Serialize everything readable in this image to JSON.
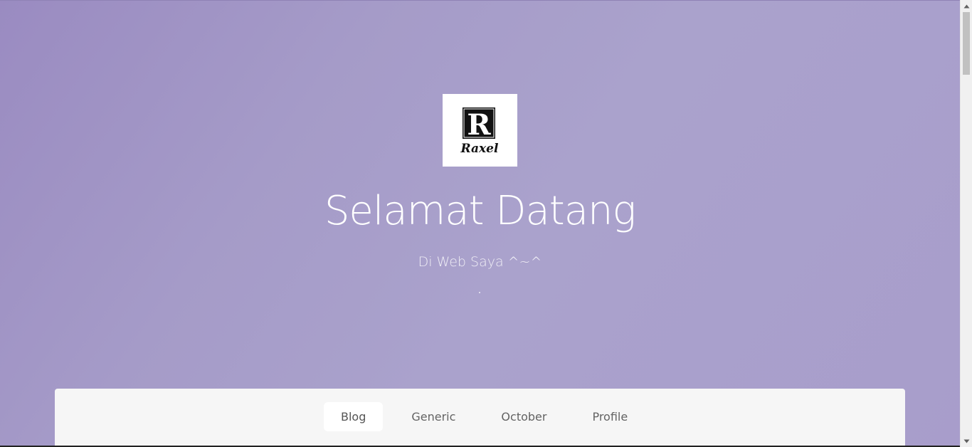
{
  "hero": {
    "logo_text": "Raxel",
    "logo_letter": "R",
    "title": "Selamat Datang",
    "subtitle": "Di Web Saya ^~^"
  },
  "nav": {
    "items": [
      {
        "label": "Blog",
        "active": true
      },
      {
        "label": "Generic",
        "active": false
      },
      {
        "label": "October",
        "active": false
      },
      {
        "label": "Profile",
        "active": false
      }
    ]
  },
  "colors": {
    "background_gradient_start": "#9a8bc1",
    "background_gradient_end": "#a89dcb",
    "nav_panel": "#f6f6f6",
    "active_tab": "#ffffff"
  },
  "icons": {
    "logo": "raxel-logo-icon",
    "scroll_up": "scroll-up-arrow-icon",
    "scroll_down": "scroll-down-arrow-icon"
  }
}
